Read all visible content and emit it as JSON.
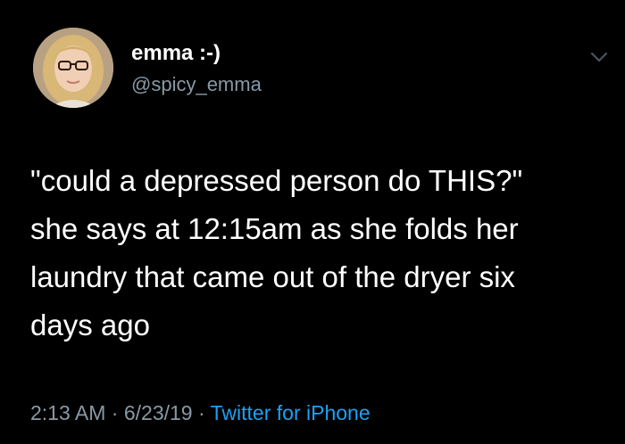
{
  "tweet": {
    "author": {
      "display_name": "emma :-)",
      "handle": "@spicy_emma"
    },
    "text_lines": [
      "\"could a depressed person do THIS?\"",
      "she says at 12:15am as she folds her",
      "laundry that came out of the dryer six",
      "days ago"
    ],
    "meta": {
      "time": "2:13 AM",
      "separator": "·",
      "date": "6/23/19",
      "source": "Twitter for iPhone"
    }
  },
  "colors": {
    "background": "#000000",
    "text": "#ffffff",
    "secondary_text": "#8899a6",
    "link": "#1da1f2"
  },
  "icons": {
    "menu": "chevron-down-icon"
  }
}
